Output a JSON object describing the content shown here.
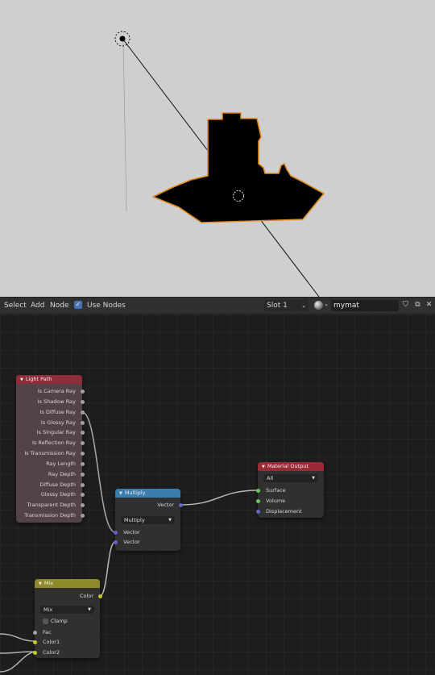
{
  "header": {
    "menu": [
      "Select",
      "Add",
      "Node"
    ],
    "use_nodes_label": "Use Nodes",
    "use_nodes_checked": true,
    "slot_label": "Slot 1",
    "material_name": "mymat"
  },
  "nodes": {
    "light_path": {
      "title": "Light Path",
      "header_color": "#8f2e3a",
      "outputs": [
        "Is Camera Ray",
        "Is Shadow Ray",
        "Is Diffuse Ray",
        "Is Glossy Ray",
        "Is Singular Ray",
        "Is Reflection Ray",
        "Is Transmission Ray",
        "Ray Length",
        "Ray Depth",
        "Diffuse Depth",
        "Glossy Depth",
        "Transparent Depth",
        "Transmission Depth"
      ]
    },
    "multiply": {
      "title": "Multiply",
      "header_color": "#3b7dae",
      "output": "Vector",
      "operation": "Multiply",
      "inputs": [
        "Vector",
        "Vector"
      ]
    },
    "material_output": {
      "title": "Material Output",
      "header_color": "#9a2a35",
      "target": "All",
      "inputs": [
        "Surface",
        "Volume",
        "Displacement"
      ]
    },
    "mix": {
      "title": "Mix",
      "header_color": "#8e8a2a",
      "output": "Color",
      "blend": "Mix",
      "clamp_label": "Clamp",
      "inputs": [
        "Fac",
        "Color1",
        "Color2"
      ]
    }
  },
  "colors": {
    "viewport_bg": "#cfcfcf",
    "selection_outline": "#e08a1e",
    "editor_bg": "#1d1d1d"
  }
}
